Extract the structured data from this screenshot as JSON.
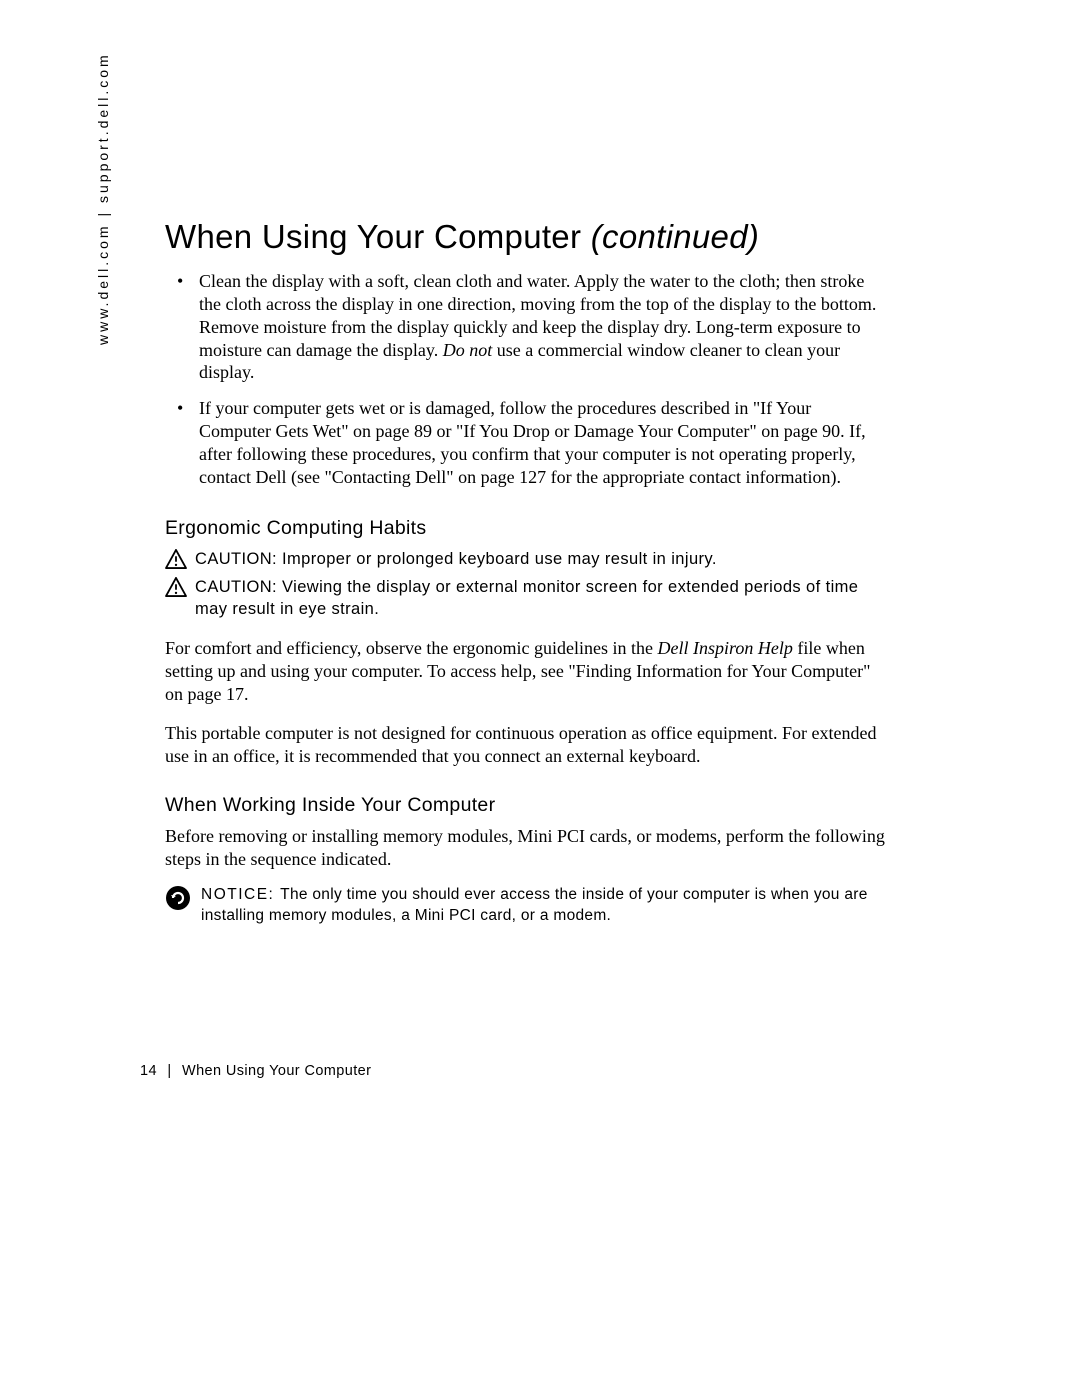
{
  "sidebar": {
    "url_text": "www.dell.com | support.dell.com"
  },
  "title": {
    "main": "When Using Your Computer ",
    "continued": "(continued)"
  },
  "bullets": [
    {
      "pre": "Clean the display with a soft, clean cloth and water. Apply the water to the cloth; then stroke the cloth across the display in one direction, moving from the top of the display to the bottom. Remove moisture from the display quickly and keep the display dry. Long-term exposure to moisture can damage the display. ",
      "emph": "Do not",
      "post": " use a commercial window cleaner to clean your display."
    },
    {
      "pre": "If your computer gets wet or is damaged, follow the procedures described in \"If Your Computer Gets Wet\" on page 89 or \"If You Drop or Damage Your Computer\" on page 90. If, after following these procedures, you confirm that your computer is not operating properly, contact Dell (see \"Contacting Dell\" on page 127 for the appropriate contact information).",
      "emph": "",
      "post": ""
    }
  ],
  "section_ergo": {
    "heading": "Ergonomic Computing Habits",
    "caution1": {
      "label": "CAUTION: ",
      "text": "Improper or prolonged keyboard use may result in injury."
    },
    "caution2": {
      "label": "CAUTION: ",
      "text": "Viewing the display or external monitor screen for extended periods of time may result in eye strain."
    },
    "para1_pre": "For comfort and efficiency, observe the ergonomic guidelines in the ",
    "para1_emph": "Dell Inspiron Help",
    "para1_post": " file when setting up and using your computer. To access help, see \"Finding Information for Your Computer\" on page 17.",
    "para2": "This portable computer is not designed for continuous operation as office equipment. For extended use in an office, it is recommended that you connect an external keyboard."
  },
  "section_inside": {
    "heading": "When Working Inside Your Computer",
    "para": "Before removing or installing memory modules, Mini PCI cards, or modems, perform the following steps in the sequence indicated.",
    "notice": {
      "label": "NOTICE: ",
      "text": "The only time you should ever access the inside of your computer is when you are installing memory modules, a Mini PCI card, or a modem."
    }
  },
  "footer": {
    "page_num": "14",
    "sep": "|",
    "section": "When Using Your Computer"
  }
}
